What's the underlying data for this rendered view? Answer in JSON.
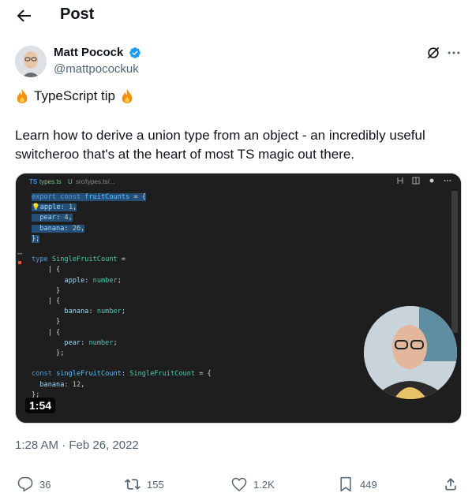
{
  "header": {
    "title": "Post"
  },
  "author": {
    "name": "Matt Pocock",
    "handle": "@mattpocockuk"
  },
  "post": {
    "tip_text": "TypeScript tip",
    "body": "Learn how to derive a union type from an object - an incredibly useful switcheroo that's at the heart of most TS magic out there.",
    "timestamp": "1:28 AM · Feb 26, 2022"
  },
  "media": {
    "tab_lang": "TS",
    "tab_file": "types.ts",
    "tab_status": "U",
    "tab_path": "src/types.ts/...",
    "video_duration": "1:54"
  },
  "actions": {
    "replies": "36",
    "reposts": "155",
    "likes": "1.2K",
    "bookmarks": "449"
  },
  "colors": {
    "accent": "#1d9bf0",
    "muted": "#536471"
  }
}
